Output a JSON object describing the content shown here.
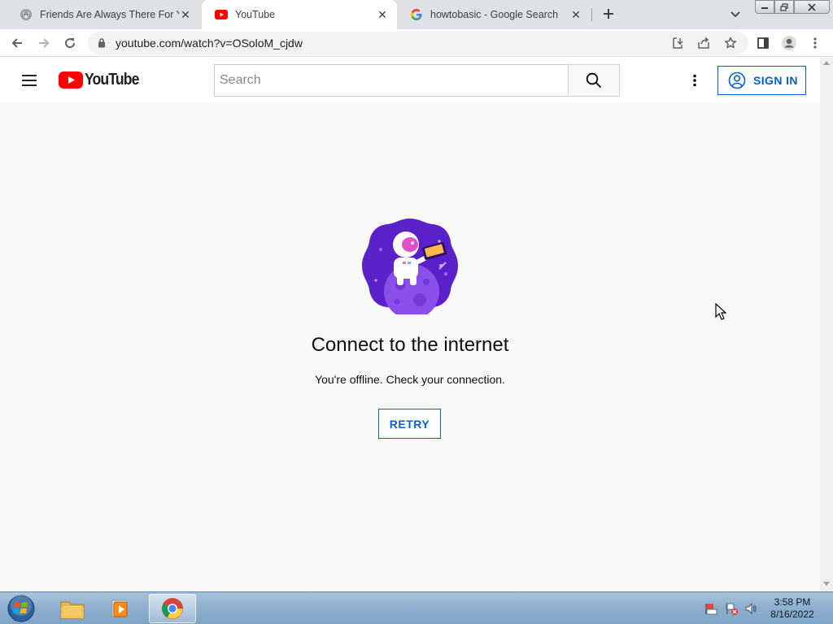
{
  "browser": {
    "tabs": [
      {
        "title": "Friends Are Always There For You",
        "favicon": "wolf-avatar-icon",
        "active": false
      },
      {
        "title": "YouTube",
        "favicon": "youtube-icon",
        "active": true
      },
      {
        "title": "howtobasic - Google Search",
        "favicon": "google-icon",
        "active": false
      }
    ],
    "url": "youtube.com/watch?v=OSoloM_cjdw"
  },
  "youtube": {
    "logo_text": "YouTube",
    "search_placeholder": "Search",
    "sign_in_label": "SIGN IN",
    "offline_title": "Connect to the internet",
    "offline_message": "You're offline. Check your connection.",
    "retry_label": "RETRY"
  },
  "taskbar": {
    "time": "3:58 PM",
    "date": "8/16/2022"
  },
  "colors": {
    "youtube_red": "#ff0000",
    "link_blue": "#065fd4",
    "astronaut_purple": "#6a2fd0"
  }
}
